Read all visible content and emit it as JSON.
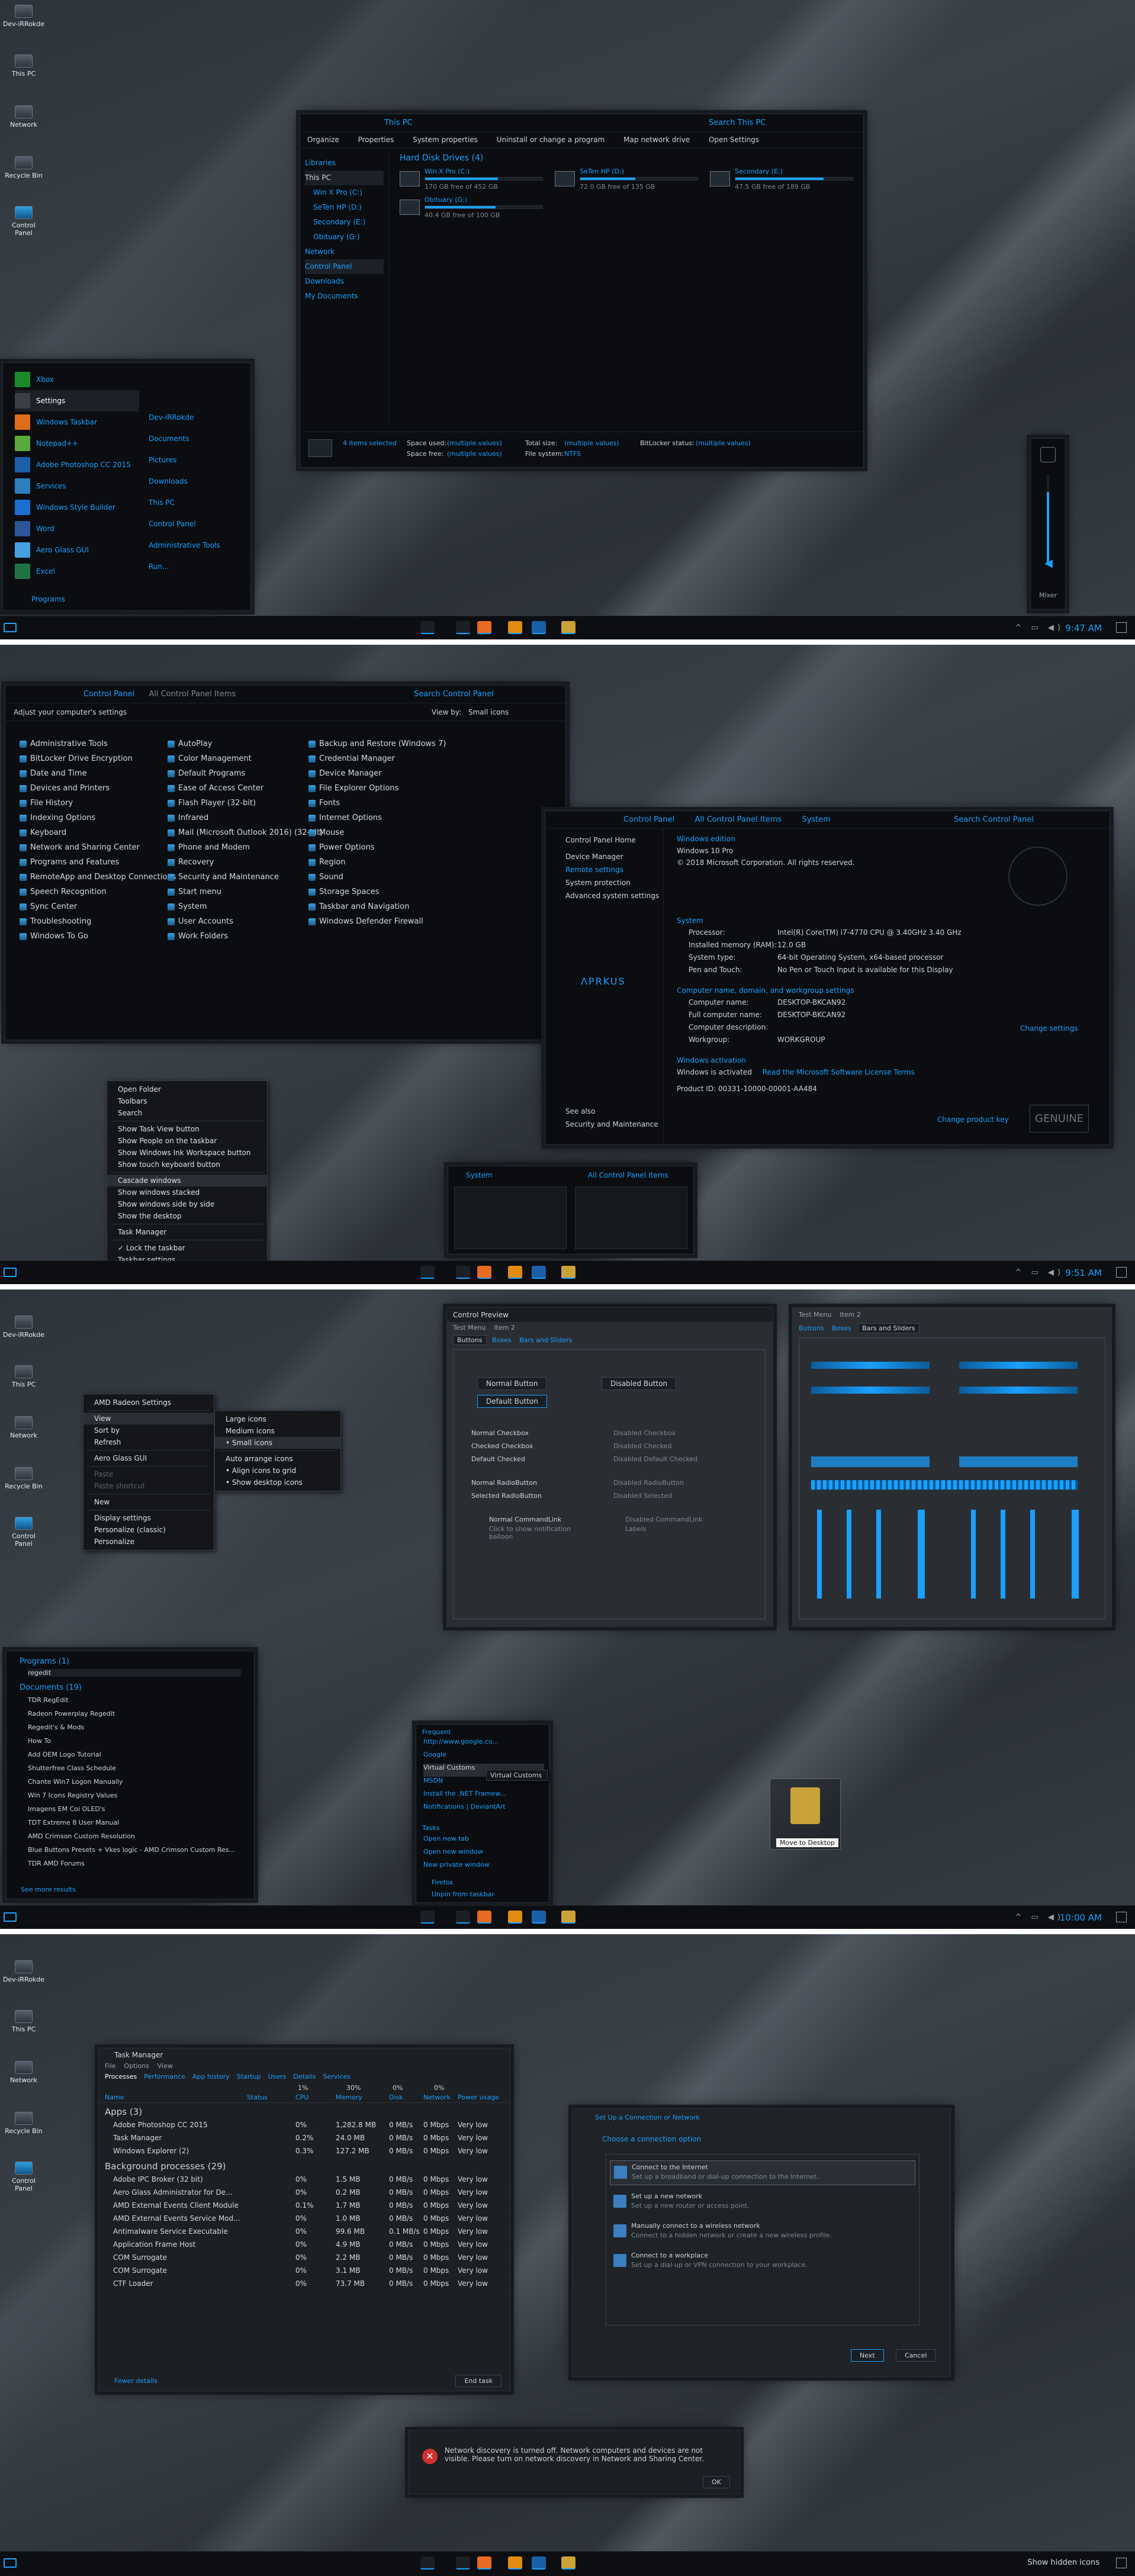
{
  "desktop_icons": [
    "Dev-iRRokde",
    "This PC",
    "Network",
    "Recycle Bin",
    "Control Panel"
  ],
  "taskbar": {
    "clock1": "9:47 AM",
    "clock2": "9:51 AM",
    "clock3": "10:00 AM",
    "last": "Show hidden icons"
  },
  "explorer": {
    "title": "This PC",
    "search": "Search This PC",
    "ribbon": [
      "Organize",
      "Properties",
      "System properties",
      "Uninstall or change a program",
      "Map network drive",
      "Open Settings"
    ],
    "nav": [
      "Libraries",
      "This PC",
      "Win X Pro (C:)",
      "SeTen HP (D:)",
      "Secondary (E:)",
      "Obituary (G:)",
      "Network",
      "Control Panel",
      "Downloads",
      "My Documents"
    ],
    "group": "Hard Disk Drives (4)",
    "drives": [
      {
        "name": "Win X Pro (C:)",
        "free": "170 GB free of 452 GB",
        "fill": 0.62
      },
      {
        "name": "SeTen HP (D:)",
        "free": "72.0 GB free of 135 GB",
        "fill": 0.47
      },
      {
        "name": "Secondary (E:)",
        "free": "47.5 GB free of 189 GB",
        "fill": 0.75
      },
      {
        "name": "Obituary (G:)",
        "free": "40.4 GB free of 100 GB",
        "fill": 0.6
      }
    ],
    "status": {
      "selected": "4 items selected",
      "space_used_l": "Space used:",
      "space_used_v": "(multiple values)",
      "total_l": "Total size:",
      "total_v": "(multiple values)",
      "bitlocker_l": "BitLocker status:",
      "bitlocker_v": "(multiple values)",
      "free_l": "Space free:",
      "free_v": "(multiple values)",
      "fs_l": "File system:",
      "fs_v": "NTFS"
    }
  },
  "start_menu": {
    "apps": [
      "Xbox",
      "Settings",
      "Windows Taskbar",
      "Notepad++",
      "Adobe Photoshop CC 2015",
      "Services",
      "Windows Style Builder",
      "Word",
      "Aero Glass GUI",
      "Excel"
    ],
    "right": [
      "Dev-iRRokde",
      "Documents",
      "Pictures",
      "Downloads",
      "This PC",
      "Control Panel",
      "Administrative Tools",
      "Run..."
    ],
    "all_programs": "Programs"
  },
  "volume": {
    "label": "Mixer"
  },
  "control_panel": {
    "breadcrumb": [
      "Control Panel",
      "All Control Panel Items"
    ],
    "search": "Search Control Panel",
    "heading": "Adjust your computer's settings",
    "view_by": "View by:",
    "view_value": "Small icons",
    "col1": [
      "Administrative Tools",
      "BitLocker Drive Encryption",
      "Date and Time",
      "Devices and Printers",
      "File History",
      "Indexing Options",
      "Keyboard",
      "Network and Sharing Center",
      "Programs and Features",
      "RemoteApp and Desktop Connections",
      "Speech Recognition",
      "Sync Center",
      "Troubleshooting",
      "Windows To Go"
    ],
    "col2": [
      "AutoPlay",
      "Color Management",
      "Default Programs",
      "Ease of Access Center",
      "Flash Player (32-bit)",
      "Infrared",
      "Mail (Microsoft Outlook 2016) (32-bit)",
      "Phone and Modem",
      "Recovery",
      "Security and Maintenance",
      "Start menu",
      "System",
      "User Accounts",
      "Work Folders"
    ],
    "col3": [
      "Backup and Restore (Windows 7)",
      "Credential Manager",
      "Device Manager",
      "File Explorer Options",
      "Fonts",
      "Internet Options",
      "Mouse",
      "Power Options",
      "Region",
      "Sound",
      "Storage Spaces",
      "Taskbar and Navigation",
      "Windows Defender Firewall"
    ]
  },
  "system": {
    "breadcrumb": [
      "Control Panel",
      "All Control Panel Items",
      "System"
    ],
    "search": "Search Control Panel",
    "left": [
      "Control Panel Home",
      "Device Manager",
      "Remote settings",
      "System protection",
      "Advanced system settings"
    ],
    "see_also": "See also",
    "security": "Security and Maintenance",
    "brand": "ΛPRKUS",
    "edition_h": "Windows edition",
    "edition": "Windows 10 Pro",
    "copyright": "© 2018 Microsoft Corporation. All rights reserved.",
    "system_h": "System",
    "sys_rows": [
      [
        "Processor:",
        "Intel(R) Core(TM) i7-4770 CPU @ 3.40GHz   3.40 GHz"
      ],
      [
        "Installed memory (RAM):",
        "12.0 GB"
      ],
      [
        "System type:",
        "64-bit Operating System, x64-based processor"
      ],
      [
        "Pen and Touch:",
        "No Pen or Touch Input is available for this Display"
      ]
    ],
    "name_h": "Computer name, domain, and workgroup settings",
    "name_rows": [
      [
        "Computer name:",
        "DESKTOP-BKCAN92"
      ],
      [
        "Full computer name:",
        "DESKTOP-BKCAN92"
      ],
      [
        "Computer description:",
        ""
      ],
      [
        "Workgroup:",
        "WORKGROUP"
      ]
    ],
    "change": "Change settings",
    "act_h": "Windows activation",
    "act": "Windows is activated",
    "license": "Read the Microsoft Software License Terms",
    "product": "Product ID: 00331-10000-00001-AA484",
    "change_key": "Change product key",
    "genuine": "GENUINE"
  },
  "taskbar_menu": {
    "items": [
      "Open Folder",
      "Toolbars",
      "Search",
      "Show Task View button",
      "Show People on the taskbar",
      "Show Windows Ink Workspace button",
      "Show touch keyboard button",
      "Cascade windows",
      "Show windows stacked",
      "Show windows side by side",
      "Show the desktop",
      "Task Manager",
      "Lock the taskbar",
      "Taskbar settings"
    ]
  },
  "thumbs": [
    "System",
    "All Control Panel Items"
  ],
  "desktop_menu": {
    "items": [
      "AMD Radeon Settings",
      "View",
      "Sort by",
      "Refresh",
      "Aero Glass GUI",
      "Paste",
      "Paste shortcut",
      "New",
      "Display settings",
      "Personalize (classic)",
      "Personalize"
    ],
    "sub": [
      "Large icons",
      "Medium icons",
      "Small icons",
      "Auto arrange icons",
      "Align icons to grid",
      "Show desktop icons"
    ]
  },
  "preview1": {
    "title": "Control Preview",
    "menu": [
      "Test Menu",
      "Item 2"
    ],
    "tabs": [
      "Buttons",
      "Boxes",
      "Bars and Sliders"
    ],
    "buttons": [
      "Normal Button",
      "Disabled Button",
      "Default Button"
    ],
    "checks": [
      "Normal Checkbox",
      "Checked Checkbox",
      "Default Checked",
      "Disabled Checkbox",
      "Disabled Checked",
      "Disabled Default Checked"
    ],
    "radios": [
      "Normal RadioButton",
      "Selected RadioButton",
      "Disabled RadioButton",
      "Disabled Selected"
    ],
    "cmd": "Normal CommandLink",
    "cmd_sub": "Click to show notification balloon",
    "cmd2": "Disabled CommandLink",
    "cmd2_sub": "Labels"
  },
  "preview2": {
    "menu": [
      "Test Menu",
      "Item 2"
    ],
    "tabs": [
      "Buttons",
      "Boxes",
      "Bars and Sliders"
    ]
  },
  "jump": {
    "programs_h": "Programs (1)",
    "program": "regedit",
    "docs_h": "Documents (19)",
    "docs": [
      "TDR RegEdit",
      "Radeon Powerplay Regedit",
      "Regedit's & Mods",
      "How To",
      "Add OEM Logo Tutorial",
      "Shutterfree Class Schedule",
      "Chante Win7 Logon Manually",
      "Win 7 Icons Registry Values",
      "Imagens EM Coi OLED's",
      "TDT Extreme 8 User Manual",
      "AMD Crimson Custom Resolution",
      "Blue Buttons Presets + Vkes logic - AMD Crimson Custom Res...",
      "TDR AMD Forums"
    ],
    "see_more": "See more results"
  },
  "browser_jump": {
    "frequent_h": "Frequent",
    "frequent": [
      "http://www.google.co...",
      "Google",
      "Virtual Customs",
      "MSDN",
      "Install the .NET Framew...",
      "Notifications | DeviantArt"
    ],
    "tooltip": "Virtual Customs",
    "tasks_h": "Tasks",
    "tasks": [
      "Open new tab",
      "Open new window",
      "New private window"
    ],
    "app": "Firefox",
    "unpin": "Unpin from taskbar"
  },
  "drag": {
    "label": "Move to Desktop"
  },
  "task_manager": {
    "title": "Task Manager",
    "menu": [
      "File",
      "Options",
      "View"
    ],
    "tabs": [
      "Processes",
      "Performance",
      "App history",
      "Startup",
      "Users",
      "Details",
      "Services"
    ],
    "header_pct": [
      "1%",
      "30%",
      "0%",
      "0%"
    ],
    "columns": [
      "Name",
      "Status",
      "CPU",
      "Memory",
      "Disk",
      "Network",
      "Power usage"
    ],
    "apps_h": "Apps (3)",
    "apps": [
      [
        "Adobe Photoshop CC 2015",
        "0%",
        "1,282.8 MB",
        "0 MB/s",
        "0 Mbps",
        "Very low"
      ],
      [
        "Task Manager",
        "0.2%",
        "24.0 MB",
        "0 MB/s",
        "0 Mbps",
        "Very low"
      ],
      [
        "Windows Explorer (2)",
        "0.3%",
        "127.2 MB",
        "0 MB/s",
        "0 Mbps",
        "Very low"
      ]
    ],
    "bg_h": "Background processes (29)",
    "bg": [
      [
        "Adobe IPC Broker (32 bit)",
        "0%",
        "1.5 MB",
        "0 MB/s",
        "0 Mbps",
        "Very low"
      ],
      [
        "Aero Glass Administrator for De...",
        "0%",
        "0.2 MB",
        "0 MB/s",
        "0 Mbps",
        "Very low"
      ],
      [
        "AMD External Events Client Module",
        "0.1%",
        "1.7 MB",
        "0 MB/s",
        "0 Mbps",
        "Very low"
      ],
      [
        "AMD External Events Service Mod...",
        "0%",
        "1.0 MB",
        "0 MB/s",
        "0 Mbps",
        "Very low"
      ],
      [
        "Antimalware Service Executable",
        "0%",
        "99.6 MB",
        "0.1 MB/s",
        "0 Mbps",
        "Very low"
      ],
      [
        "Application Frame Host",
        "0%",
        "4.9 MB",
        "0 MB/s",
        "0 Mbps",
        "Very low"
      ],
      [
        "COM Surrogate",
        "0%",
        "2.2 MB",
        "0 MB/s",
        "0 Mbps",
        "Very low"
      ],
      [
        "COM Surrogate",
        "0%",
        "3.1 MB",
        "0 MB/s",
        "0 Mbps",
        "Very low"
      ],
      [
        "CTF Loader",
        "0%",
        "73.7 MB",
        "0 MB/s",
        "0 Mbps",
        "Very low"
      ]
    ],
    "fewer": "Fewer details",
    "end": "End task"
  },
  "connection": {
    "title": "Set Up a Connection or Network",
    "heading": "Choose a connection option",
    "options": [
      [
        "Connect to the Internet",
        "Set up a broadband or dial-up connection to the Internet."
      ],
      [
        "Set up a new network",
        "Set up a new router or access point."
      ],
      [
        "Manually connect to a wireless network",
        "Connect to a hidden network or create a new wireless profile."
      ],
      [
        "Connect to a workplace",
        "Set up a dial-up or VPN connection to your workplace."
      ]
    ],
    "next": "Next",
    "cancel": "Cancel"
  },
  "dialog": {
    "message": "Network discovery is turned off. Network computers and devices are not visible. Please turn on network discovery in Network and Sharing Center.",
    "ok": "OK"
  },
  "colors": {
    "accent": "#1aa0ff",
    "window": "#0b0d10"
  }
}
